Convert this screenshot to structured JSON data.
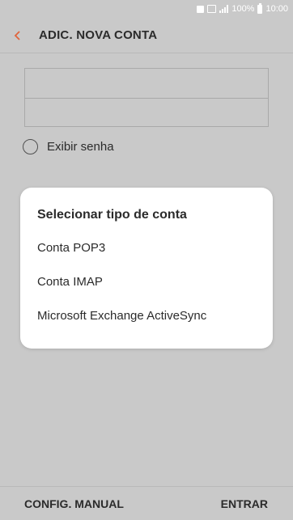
{
  "status_bar": {
    "battery": "100%",
    "time": "10:00"
  },
  "app_bar": {
    "title": "ADIC. NOVA CONTA",
    "accent_color": "#e0643c"
  },
  "form": {
    "show_password_label": "Exibir senha"
  },
  "dialog": {
    "title": "Selecionar tipo de conta",
    "options": [
      "Conta POP3",
      "Conta IMAP",
      "Microsoft Exchange ActiveSync"
    ]
  },
  "bottom_bar": {
    "left_label": "CONFIG. MANUAL",
    "right_label": "ENTRAR"
  }
}
